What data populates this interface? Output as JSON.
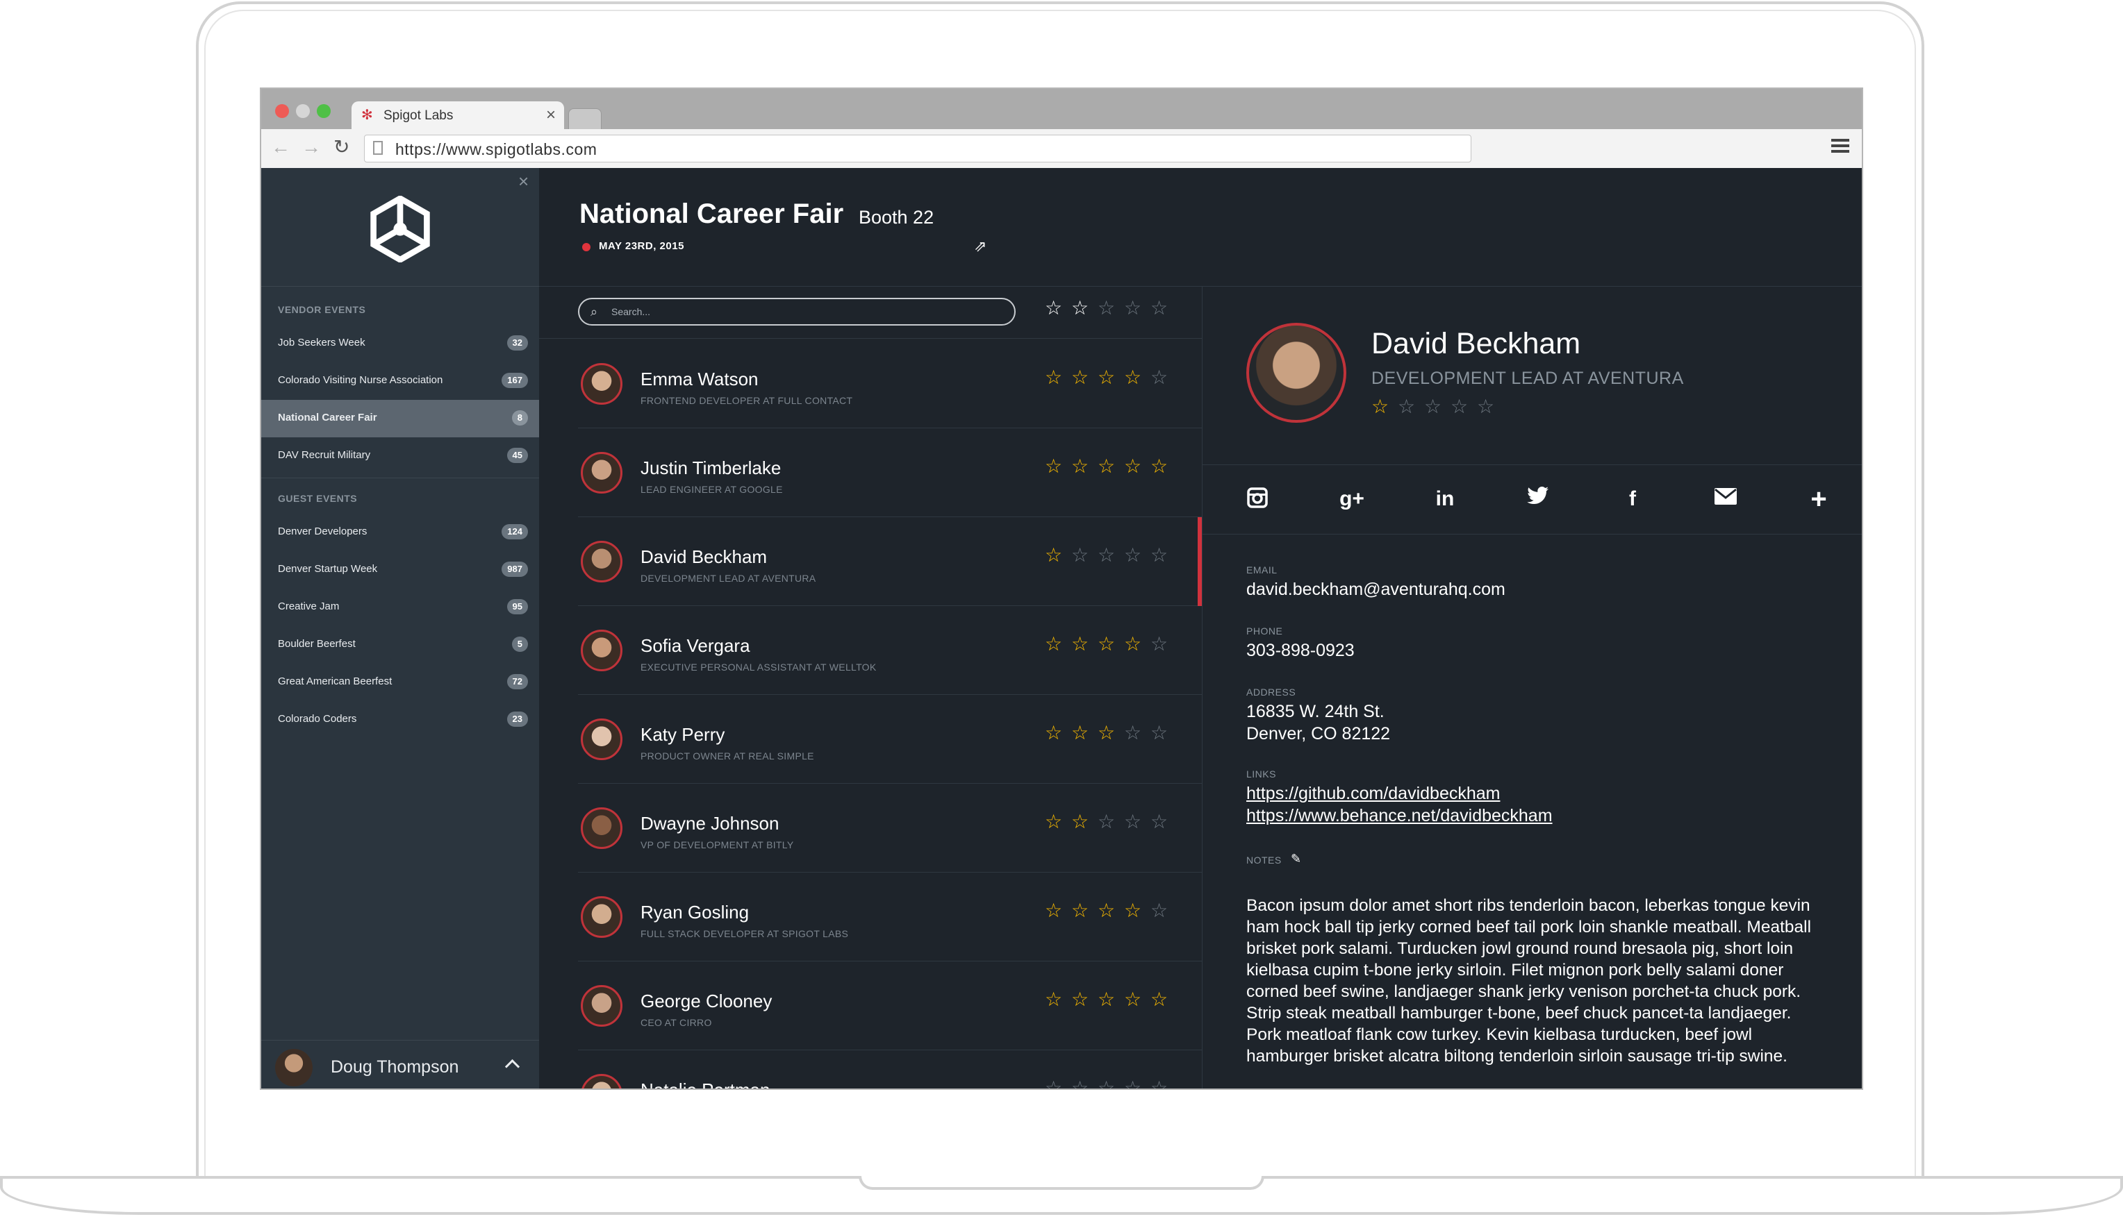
{
  "browser": {
    "tab_title": "Spigot Labs",
    "url": "https://www.spigotlabs.com"
  },
  "sidebar": {
    "vendor_section": "VENDOR EVENTS",
    "vendor_events": [
      {
        "label": "Job Seekers Week",
        "count": "32"
      },
      {
        "label": "Colorado Visiting Nurse Association",
        "count": "167"
      },
      {
        "label": "National Career Fair",
        "count": "8"
      },
      {
        "label": "DAV Recruit Military",
        "count": "45"
      }
    ],
    "guest_section": "GUEST EVENTS",
    "guest_events": [
      {
        "label": "Denver Developers",
        "count": "124"
      },
      {
        "label": "Denver Startup Week",
        "count": "987"
      },
      {
        "label": "Creative Jam",
        "count": "95"
      },
      {
        "label": "Boulder Beerfest",
        "count": "5"
      },
      {
        "label": "Great American Beerfest",
        "count": "72"
      },
      {
        "label": "Colorado Coders",
        "count": "23"
      }
    ],
    "user_name": "Doug Thompson"
  },
  "header": {
    "title": "National Career Fair",
    "booth": "Booth 22",
    "date": "MAY 23RD, 2015"
  },
  "list": {
    "search_placeholder": "Search...",
    "filter_rating": 2,
    "people": [
      {
        "name": "Emma Watson",
        "role": "FRONTEND DEVELOPER AT FULL CONTACT",
        "rating": 4
      },
      {
        "name": "Justin Timberlake",
        "role": "LEAD ENGINEER AT GOOGLE",
        "rating": 5
      },
      {
        "name": "David Beckham",
        "role": "DEVELOPMENT LEAD AT AVENTURA",
        "rating": 1
      },
      {
        "name": "Sofia Vergara",
        "role": "EXECUTIVE PERSONAL ASSISTANT AT WELLTOK",
        "rating": 4
      },
      {
        "name": "Katy Perry",
        "role": "PRODUCT OWNER AT REAL SIMPLE",
        "rating": 3
      },
      {
        "name": "Dwayne Johnson",
        "role": "VP OF DEVELOPMENT AT BITLY",
        "rating": 2
      },
      {
        "name": "Ryan Gosling",
        "role": "FULL STACK DEVELOPER AT SPIGOT LABS",
        "rating": 4
      },
      {
        "name": "George Clooney",
        "role": "CEO AT CIRRO",
        "rating": 5
      },
      {
        "name": "Natalie Portman",
        "role": "",
        "rating": 0
      }
    ]
  },
  "detail": {
    "name": "David Beckham",
    "role": "DEVELOPMENT LEAD AT AVENTURA",
    "rating": 1,
    "email_label": "EMAIL",
    "email": "david.beckham@aventurahq.com",
    "phone_label": "PHONE",
    "phone": "303-898-0923",
    "address_label": "ADDRESS",
    "address_line1": "16835 W. 24th St.",
    "address_line2": "Denver, CO 82122",
    "links_label": "LINKS",
    "link1": "https://github.com/davidbeckham",
    "link2": "https://www.behance.net/davidbeckham",
    "notes_label": "NOTES",
    "notes": "Bacon ipsum dolor amet short ribs tenderloin bacon, leberkas tongue kevin ham hock ball tip jerky corned beef tail pork loin shankle meatball. Meatball brisket pork salami. Turducken jowl ground round bresaola pig, short loin kielbasa cupim t-bone jerky sirloin. Filet mignon pork belly salami doner corned beef swine, landjaeger shank jerky venison porchet-ta chuck pork. Strip steak meatball hamburger t-bone, beef chuck pancet-ta landjaeger. Pork meatloaf flank cow turkey. Kevin kielbasa turducken, beef jowl hamburger brisket alcatra biltong tenderloin sirloin sausage tri-tip swine."
  },
  "colors": {
    "accent": "#d1323d",
    "star": "#f5b700",
    "background": "#1e242b",
    "sidebar": "#2b353e"
  },
  "icons": [
    "instagram-icon",
    "google-plus-icon",
    "linkedin-icon",
    "twitter-icon",
    "facebook-icon",
    "email-icon",
    "plus-icon"
  ]
}
